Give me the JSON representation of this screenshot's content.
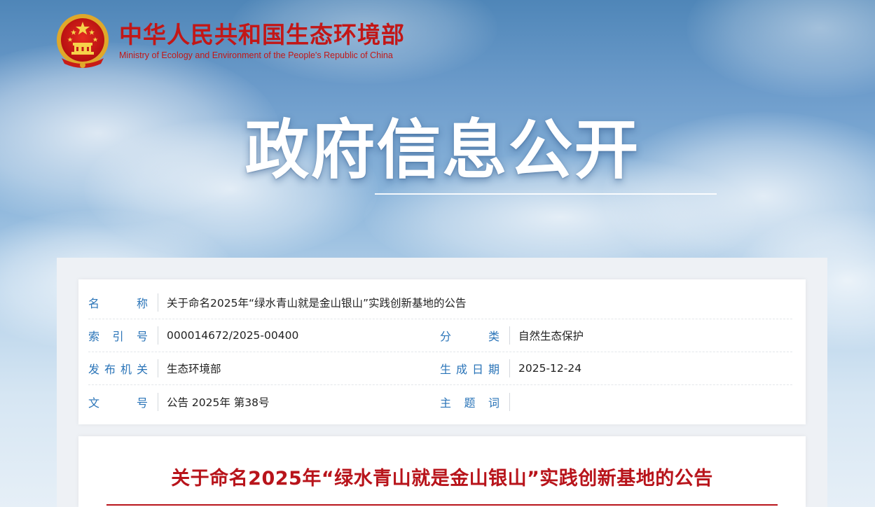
{
  "header": {
    "org_cn": "中华人民共和国生态环境部",
    "org_en": "Ministry of Ecology and Environment of the People's Republic of China",
    "emblem_icon": "national-emblem-icon"
  },
  "page_title": "政府信息公开",
  "meta": {
    "name_label": [
      "名",
      "称"
    ],
    "name_value": "关于命名2025年“绿水青山就是金山银山”实践创新基地的公告",
    "index_label": [
      "索",
      "引",
      "号"
    ],
    "index_value": "000014672/2025-00400",
    "category_label": [
      "分",
      "类"
    ],
    "category_value": "自然生态保护",
    "issuer_label": [
      "发",
      "布",
      "机",
      "关"
    ],
    "issuer_value": "生态环境部",
    "date_label": [
      "生",
      "成",
      "日",
      "期"
    ],
    "date_value": "2025-12-24",
    "docno_label": [
      "文",
      "号"
    ],
    "docno_value": "公告 2025年 第38号",
    "subject_label": [
      "主",
      "题",
      "词"
    ],
    "subject_value": ""
  },
  "article": {
    "title": "关于命名2025年“绿水青山就是金山银山”实践创新基地的公告"
  },
  "colors": {
    "brand_red": "#c21717",
    "label_blue": "#2a74b8",
    "article_red": "#b8141b"
  }
}
